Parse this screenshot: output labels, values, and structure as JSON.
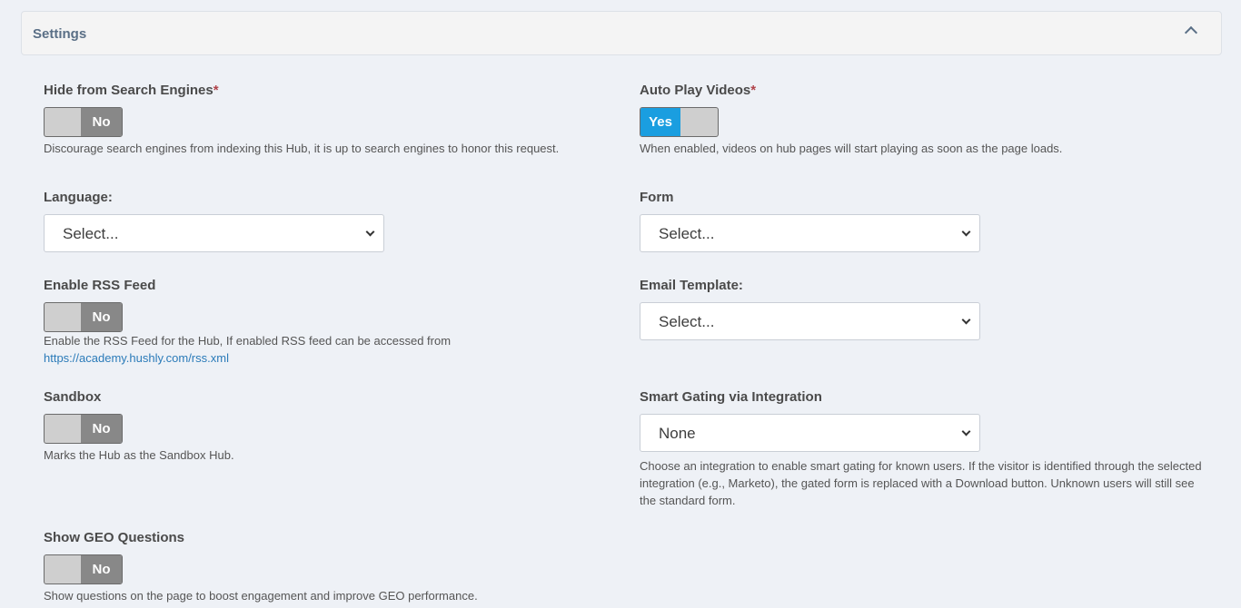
{
  "panel": {
    "title": "Settings"
  },
  "hide_search": {
    "label": "Hide from Search Engines",
    "required_mark": "*",
    "toggle": "No",
    "help": "Discourage search engines from indexing this Hub, it is up to search engines to honor this request."
  },
  "auto_play": {
    "label": "Auto Play Videos",
    "required_mark": "*",
    "toggle": "Yes",
    "help": "When enabled, videos on hub pages will start playing as soon as the page loads."
  },
  "language": {
    "label": "Language:",
    "value": "Select..."
  },
  "form": {
    "label": "Form",
    "value": "Select..."
  },
  "rss": {
    "label": "Enable RSS Feed",
    "toggle": "No",
    "help": "Enable the RSS Feed for the Hub, If enabled RSS feed can be accessed from",
    "link": "https://academy.hushly.com/rss.xml"
  },
  "email_template": {
    "label": "Email Template:",
    "value": "Select..."
  },
  "sandbox": {
    "label": "Sandbox",
    "toggle": "No",
    "help": "Marks the Hub as the Sandbox Hub."
  },
  "smart_gating": {
    "label": "Smart Gating via Integration",
    "value": "None",
    "help": "Choose an integration to enable smart gating for known users. If the visitor is identified through the selected integration (e.g., Marketo), the gated form is replaced with a Download button. Unknown users will still see the standard form."
  },
  "geo": {
    "label": "Show GEO Questions",
    "toggle": "No",
    "help": "Show questions on the page to boost engagement and improve GEO performance."
  },
  "colors": {
    "accent": "#1a9ee0",
    "toggle_off": "#888888",
    "link": "#2b7bb9"
  }
}
